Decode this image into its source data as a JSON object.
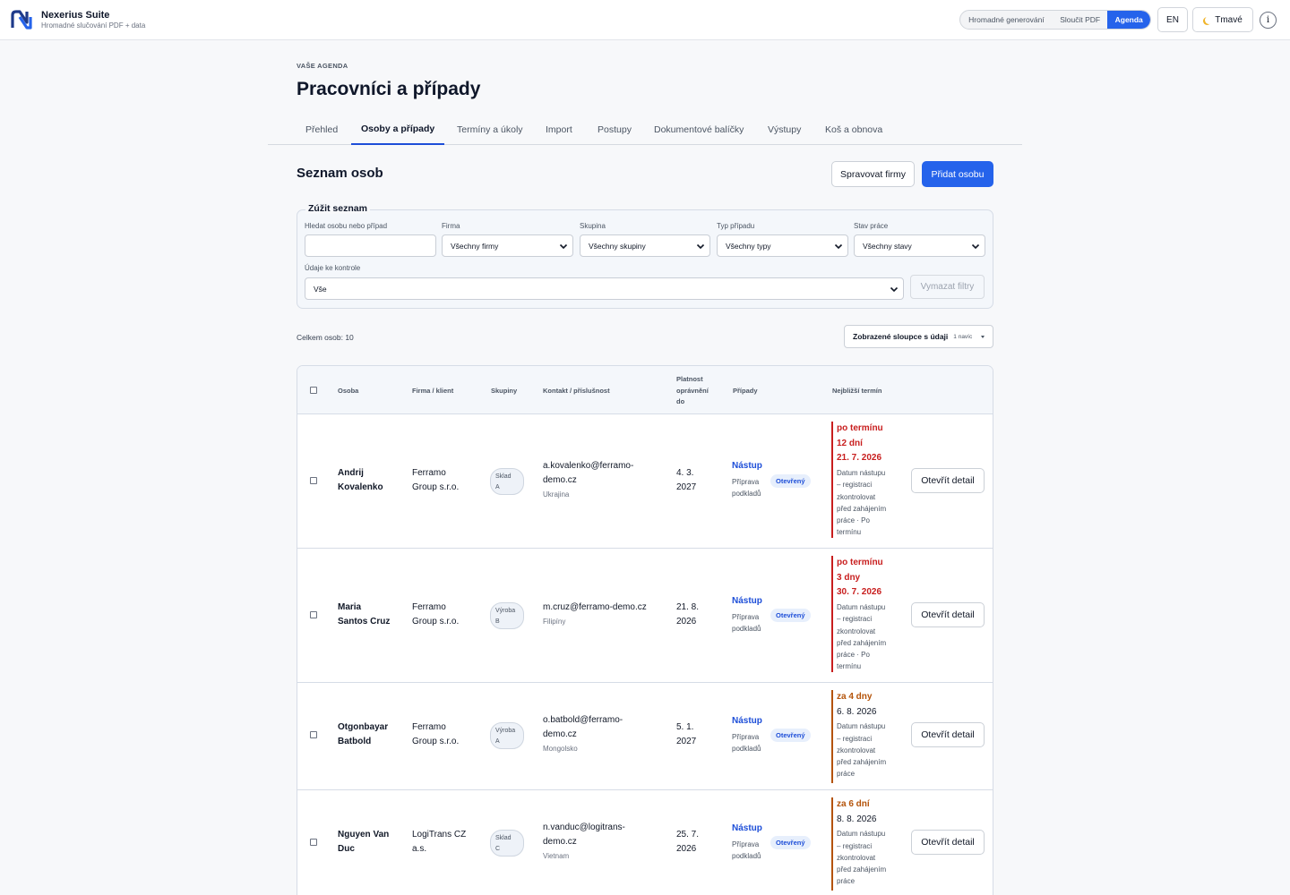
{
  "app": {
    "name": "Nexerius Suite",
    "subtitle": "Hromadné slučování PDF + data",
    "modes": [
      "Hromadné generování",
      "Sloučit PDF",
      "Agenda"
    ],
    "active_mode": "Agenda",
    "language_button": "EN",
    "theme_button": "Tmavé",
    "info_button": "i",
    "accent_color": "#2563eb"
  },
  "header": {
    "eyebrow": "VAŠE AGENDA",
    "title": "Pracovníci a případy",
    "tabs": [
      {
        "label": "Přehled"
      },
      {
        "label": "Osoby a případy",
        "active": true
      },
      {
        "label": "Termíny a úkoly"
      },
      {
        "label": "Import"
      },
      {
        "label": "Postupy"
      },
      {
        "label": "Dokumentové balíčky"
      },
      {
        "label": "Výstupy"
      },
      {
        "label": "Koš a obnova"
      }
    ]
  },
  "section": {
    "title": "Seznam osob",
    "manage_companies": "Spravovat firmy",
    "add_person": "Přidat osobu"
  },
  "filters": {
    "legend": "Zúžit seznam",
    "search_label": "Hledat osobu nebo případ",
    "search_value": "",
    "company_label": "Firma",
    "company_value": "Všechny firmy",
    "group_label": "Skupina",
    "group_value": "Všechny skupiny",
    "case_type_label": "Typ případu",
    "case_type_value": "Všechny typy",
    "work_status_label": "Stav práce",
    "work_status_value": "Všechny stavy",
    "check_label": "Údaje ke kontrole",
    "check_value": "Vše",
    "clear_button": "Vymazat filtry"
  },
  "list": {
    "total": "Celkem osob: 10",
    "columns_button": "Zobrazené sloupce s údaji",
    "columns_extra": "1 navíc"
  },
  "table": {
    "headers": {
      "person": "Osoba",
      "company": "Firma / klient",
      "groups": "Skupiny",
      "contact": "Kontakt / příslušnost",
      "valid_1": "Platnost",
      "valid_2": "oprávnění",
      "valid_3": "do",
      "cases": "Případy",
      "deadline": "Nejbližší termín"
    },
    "detail_button": "Otevřít detail",
    "rows": [
      {
        "name_1": "Andrij",
        "name_2": "Kovalenko",
        "company_1": "Ferramo",
        "company_2": "Group s.r.o.",
        "group_1": "Sklad",
        "group_2": "A",
        "email_1": "a.kovalenko@ferramo-",
        "email_2": "demo.cz",
        "country": "Ukrajina",
        "valid_1": "4. 3.",
        "valid_2": "2027",
        "case_type": "Nástup",
        "case_stage_1": "Příprava",
        "case_stage_2": "podkladů",
        "case_status": "Otevřený",
        "dl_status_1": "po termínu",
        "dl_status_2": "12 dní",
        "dl_date": "21. 7. 2026",
        "dl_note_1": "Datum nástupu",
        "dl_note_2": "– registraci",
        "dl_note_3": "zkontrolovat",
        "dl_note_4": "před zahájením",
        "dl_note_5": "práce · Po",
        "dl_note_6": "termínu"
      },
      {
        "name_1": "Maria",
        "name_2": "Santos Cruz",
        "company_1": "Ferramo",
        "company_2": "Group s.r.o.",
        "group_1": "Výroba",
        "group_2": "B",
        "email_1": "m.cruz@ferramo-demo.cz",
        "email_2": "",
        "country": "Filipíny",
        "valid_1": "21. 8.",
        "valid_2": "2026",
        "case_type": "Nástup",
        "case_stage_1": "Příprava",
        "case_stage_2": "podkladů",
        "case_status": "Otevřený",
        "dl_status_1": "po termínu",
        "dl_status_2": "3 dny",
        "dl_date": "30. 7. 2026",
        "dl_note_1": "Datum nástupu",
        "dl_note_2": "– registraci",
        "dl_note_3": "zkontrolovat",
        "dl_note_4": "před zahájením",
        "dl_note_5": "práce · Po",
        "dl_note_6": "termínu"
      },
      {
        "name_1": "Otgonbayar",
        "name_2": "Batbold",
        "company_1": "Ferramo",
        "company_2": "Group s.r.o.",
        "group_1": "Výroba",
        "group_2": "A",
        "email_1": "o.batbold@ferramo-",
        "email_2": "demo.cz",
        "country": "Mongolsko",
        "valid_1": "5. 1.",
        "valid_2": "2027",
        "case_type": "Nástup",
        "case_stage_1": "Příprava",
        "case_stage_2": "podkladů",
        "case_status": "Otevřený",
        "dl_status": "za 4 dny",
        "dl_date": "6. 8. 2026",
        "dl_note_1": "Datum nástupu",
        "dl_note_2": "– registraci",
        "dl_note_3": "zkontrolovat",
        "dl_note_4": "před zahájením",
        "dl_note_5": "práce"
      },
      {
        "name_1": "Nguyen Van",
        "name_2": "Duc",
        "company_1": "LogiTrans CZ",
        "company_2": "a.s.",
        "group_1": "Sklad",
        "group_2": "C",
        "email_1": "n.vanduc@logitrans-",
        "email_2": "demo.cz",
        "country": "Vietnam",
        "valid_1": "25. 7.",
        "valid_2": "2026",
        "case_type": "Nástup",
        "case_stage_1": "Příprava",
        "case_stage_2": "podkladů",
        "case_status": "Otevřený",
        "dl_status": "za 6 dní",
        "dl_date": "8. 8. 2026",
        "dl_note_1": "Datum nástupu",
        "dl_note_2": "– registraci",
        "dl_note_3": "zkontrolovat",
        "dl_note_4": "před zahájením",
        "dl_note_5": "práce"
      }
    ]
  },
  "colors": {
    "overdue": "#c81e1e",
    "upcoming": "#b45309",
    "badge_bg": "#e7effc"
  }
}
